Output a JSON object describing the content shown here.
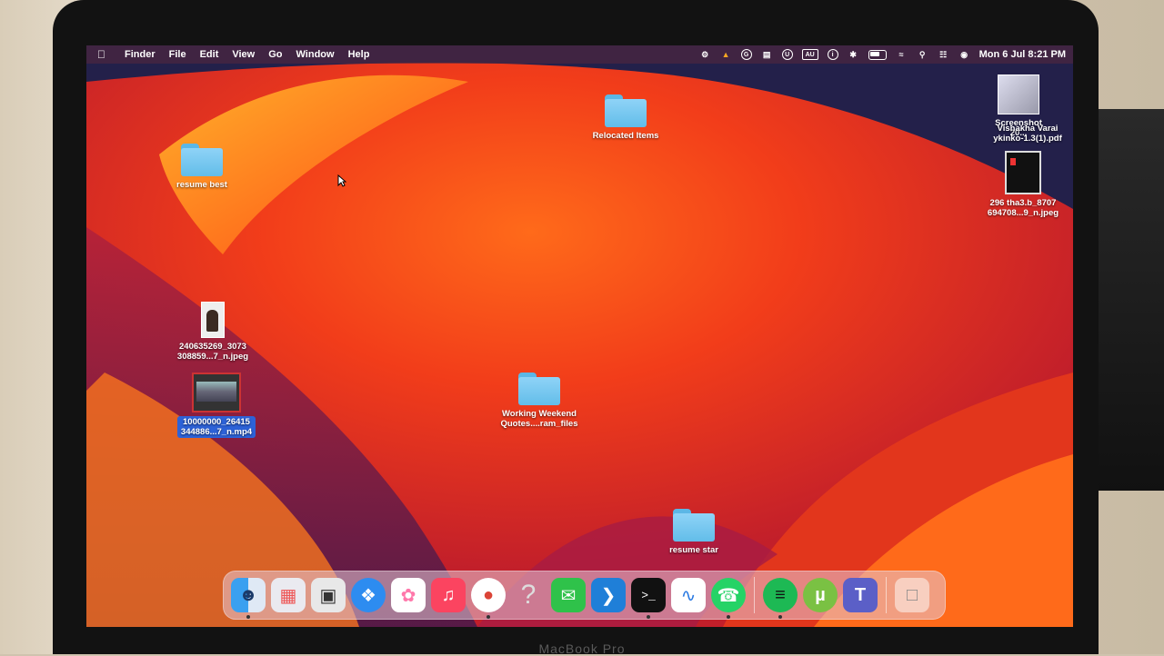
{
  "menubar": {
    "app_name": "Finder",
    "menus": [
      "File",
      "Edit",
      "View",
      "Go",
      "Window",
      "Help"
    ],
    "status_icons": [
      "malwarebytes-icon",
      "flame-icon",
      "grammarly-icon",
      "display-icon",
      "vpn-icon",
      "input-source-icon",
      "accessibility-icon",
      "bluetooth-icon",
      "battery-icon",
      "wifi-icon",
      "spotlight-icon",
      "control-center-icon",
      "siri-icon"
    ],
    "input_source": "AU",
    "clock": "Mon 6 Jul  8:21 PM"
  },
  "desktop": {
    "items": [
      {
        "name": "resume best",
        "kind": "folder"
      },
      {
        "name": "Relocated Items",
        "kind": "folder"
      },
      {
        "name": "240635269_3073\n308859...7_n.jpeg",
        "kind": "image"
      },
      {
        "name": "10000000_26415\n344886...7_n.mp4",
        "kind": "video",
        "selected": true
      },
      {
        "name": "Working Weekend\nQuotes....ram_files",
        "kind": "folder"
      },
      {
        "name": "resume star",
        "kind": "folder"
      },
      {
        "name": "Screenshot\n20...",
        "kind": "image"
      },
      {
        "name": "Vishakha Varai\nykinko-1.3(1).pdf",
        "kind": "pdf"
      },
      {
        "name": "296 tha3.b_8707\n694708...9_n.jpeg",
        "kind": "image"
      }
    ]
  },
  "dock": {
    "apps": [
      "Finder",
      "Launchpad",
      "Screenshot",
      "Safari",
      "Photos",
      "Music",
      "Google Chrome",
      "Unknown App",
      "Messages",
      "Visual Studio Code",
      "Terminal",
      "Freeform",
      "WhatsApp",
      "Spotify",
      "uTorrent",
      "Microsoft Teams",
      "Trash"
    ]
  },
  "hardware": {
    "brand_label": "MacBook Pro"
  }
}
